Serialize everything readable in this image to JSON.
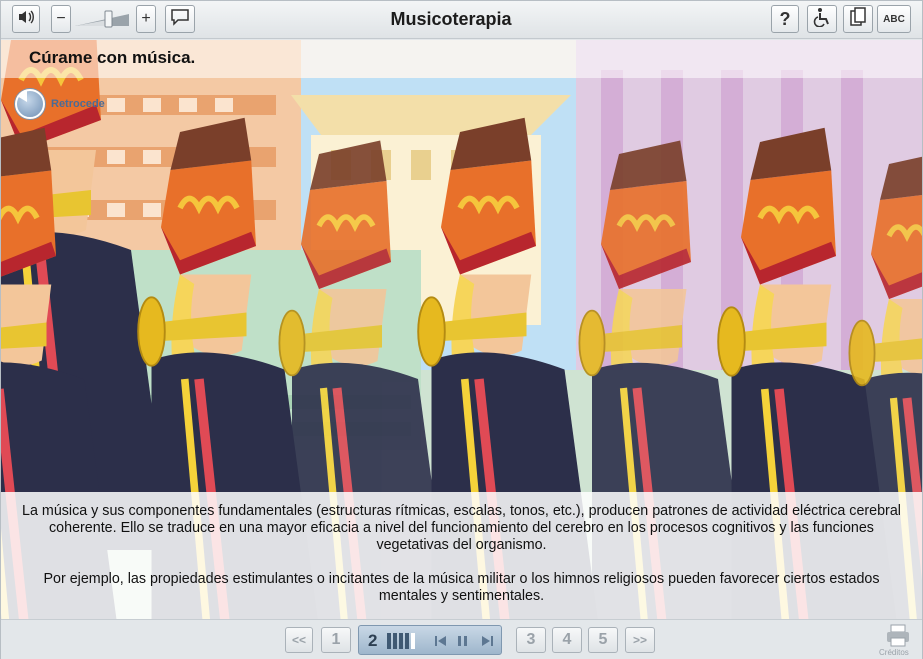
{
  "app": {
    "title": "Musicoterapia"
  },
  "toolbar": {
    "volume_icon": "speaker-icon",
    "minus_label": "−",
    "plus_label": "+",
    "caption_icon": "speech-bubble-icon",
    "help_label": "?",
    "accessibility_icon": "wheelchair-icon",
    "copy_icon": "copy-icon",
    "abc_label": "ABC"
  },
  "page": {
    "subtitle": "Cúrame con música.",
    "back_label": "Retrocede",
    "paragraphs": [
      "La música y sus componentes fundamentales (estructuras rítmicas, escalas, tonos, etc.), producen patrones de actividad eléctrica cerebral coherente. Ello se traduce en una mayor eficacia a nivel del funcionamiento del cerebro en los procesos cognitivos y las funciones vegetativas del organismo.",
      "Por ejemplo, las propiedades estimulantes o incitantes de la música militar o los himnos religiosos pueden favorecer ciertos estados mentales y sentimentales."
    ],
    "image_icon": "marching-band-trumpeters-illustration"
  },
  "navigation": {
    "first_label": "<<",
    "pages": [
      "1",
      "2",
      "3",
      "4",
      "5"
    ],
    "current_page": "2",
    "last_label": ">>",
    "progress_steps_total": 5,
    "progress_steps_done": 4,
    "credits_label": "Créditos"
  },
  "colors": {
    "accent": "#9eb6cc",
    "hat_orange": "#e8702a",
    "jacket": "#2c2f4a",
    "brass": "#e8c531"
  }
}
